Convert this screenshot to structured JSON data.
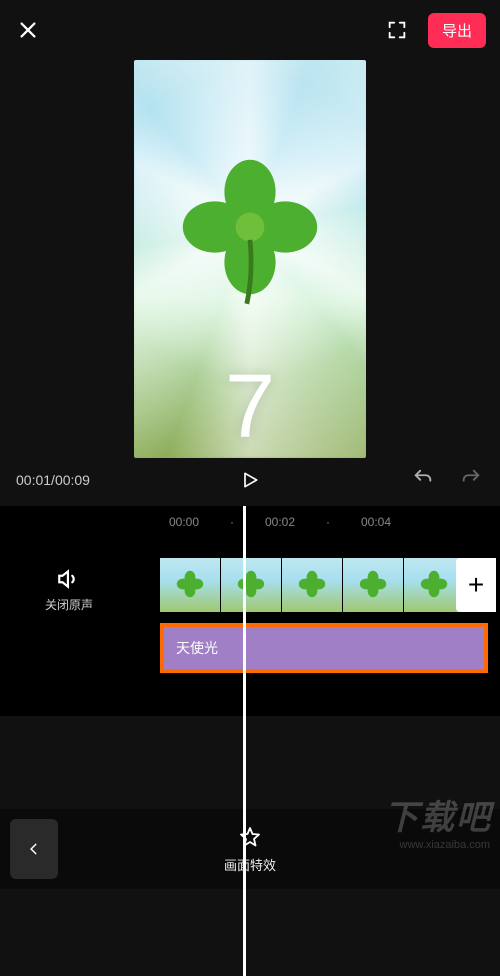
{
  "topbar": {
    "export_label": "导出"
  },
  "preview": {
    "overlay_number": "7"
  },
  "player": {
    "current_time": "00:01",
    "total_time": "00:09"
  },
  "ruler": {
    "ticks": [
      "00:00",
      "00:02",
      "00:04"
    ]
  },
  "audio": {
    "mute_label": "关闭原声"
  },
  "effect": {
    "name": "天使光"
  },
  "bottombar": {
    "fx_label": "画面特效"
  },
  "watermark": {
    "main": "下载吧",
    "sub": "www.xiazaiba.com"
  },
  "colors": {
    "accent": "#ff2d55",
    "highlight_border": "#ff6a00",
    "effect_bar": "#a07fc7"
  }
}
